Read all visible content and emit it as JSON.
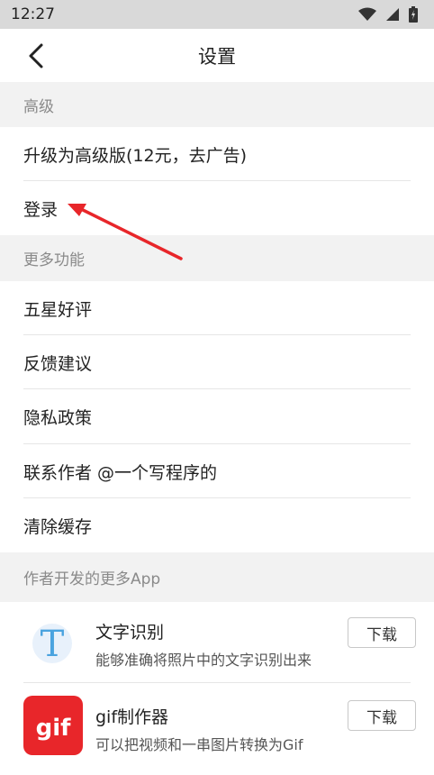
{
  "status_bar": {
    "time": "12:27"
  },
  "nav": {
    "title": "设置"
  },
  "sections": {
    "advanced": "高级",
    "more_features": "更多功能",
    "more_apps": "作者开发的更多App"
  },
  "advanced_items": {
    "upgrade": "升级为高级版(12元，去广告)",
    "login": "登录"
  },
  "more_items": {
    "rate": "五星好评",
    "feedback": "反馈建议",
    "privacy": "隐私政策",
    "contact": "联系作者 @一个写程序的",
    "clear_cache": "清除缓存"
  },
  "apps": [
    {
      "name": "文字识别",
      "desc": "能够准确将照片中的文字识别出来",
      "button": "下载",
      "icon_letter": "T"
    },
    {
      "name": "gif制作器",
      "desc": "可以把视频和一串图片转换为Gif",
      "button": "下载",
      "icon_letter": "gif"
    }
  ],
  "colors": {
    "accent_red": "#e8262a",
    "icon_blue": "#4aa3df",
    "gif_red": "#e8262a"
  }
}
